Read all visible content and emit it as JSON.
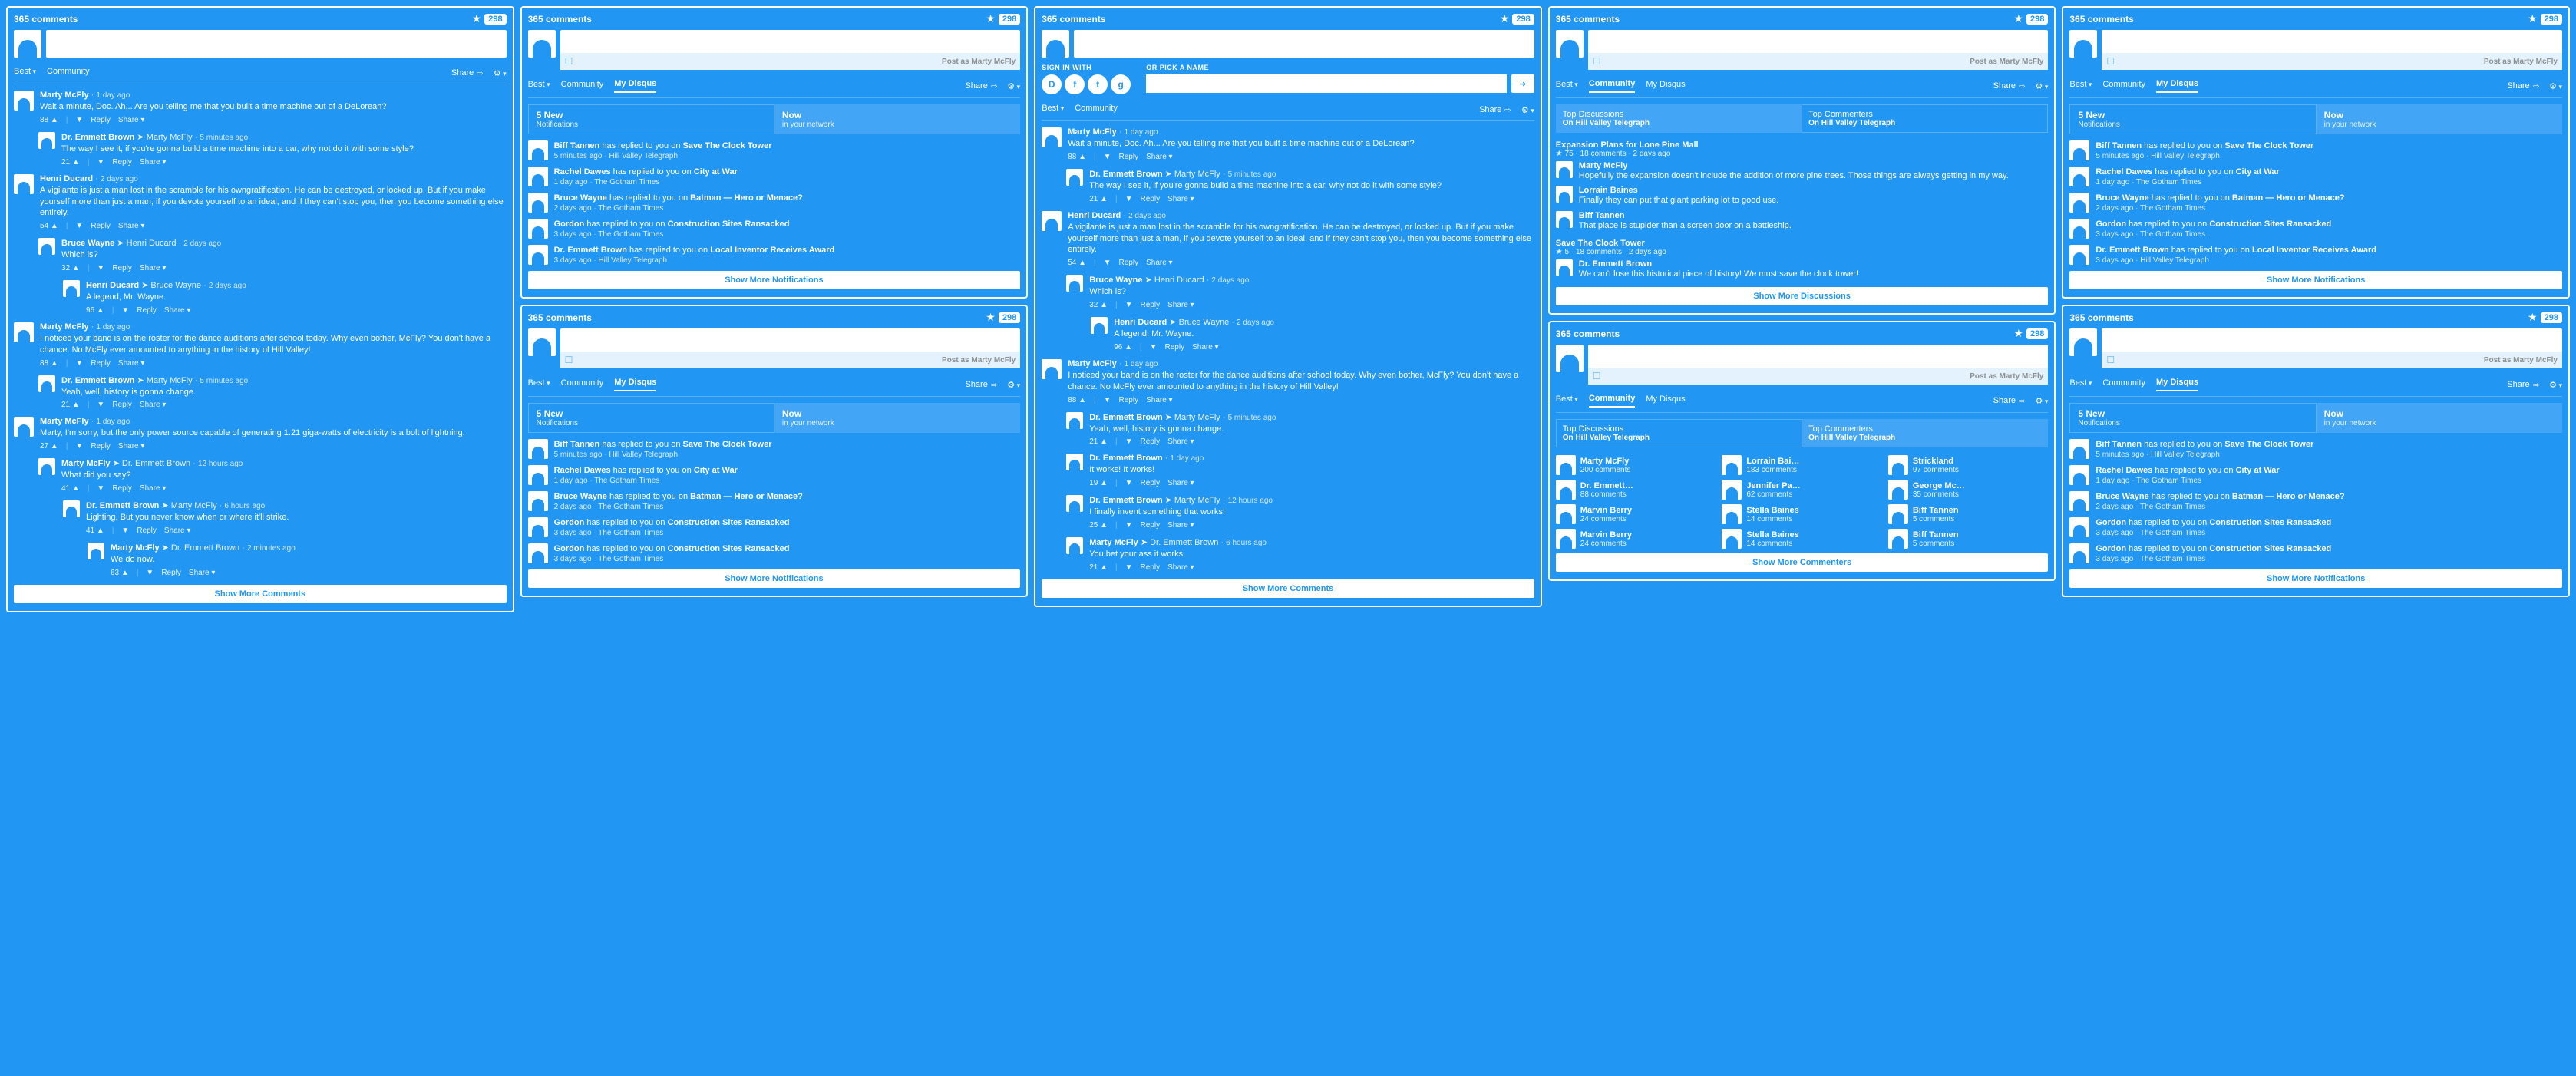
{
  "global": {
    "comments_title": "365 comments",
    "favorite_count": "298",
    "post_as": "Post as Marty McFly",
    "tabs": {
      "best": "Best",
      "community": "Community",
      "my_disqus": "My Disqus"
    },
    "toolbar": {
      "share": "Share",
      "settings": ""
    },
    "notif_tabs": {
      "count": "5 New",
      "count_sub": "Notifications",
      "now": "Now",
      "now_sub": "in your network"
    },
    "show_more_comments": "Show More Comments",
    "show_more_notifications": "Show More Notifications",
    "show_more_discussions": "Show More Discussions",
    "show_more_commenters": "Show More Commenters",
    "signin_with": "SIGN IN WITH",
    "pick_name": "OR PICK A NAME",
    "social": {
      "d": "D",
      "f": "f",
      "t": "t",
      "g": "g"
    }
  },
  "actions": {
    "reply": "Reply",
    "share": "Share",
    "up": "▲",
    "down": "▼",
    "sep": "|"
  },
  "community_tabs": {
    "top_disc": "Top Discussions",
    "top_disc_sub": "On Hill Valley Telegraph",
    "top_comm": "Top Commenters",
    "top_comm_sub": "On Hill Valley Telegraph"
  },
  "notifications": [
    {
      "who": "Biff Tannen",
      "action": "has replied to you on",
      "topic": "Save The Clock Tower",
      "time": "5 minutes ago",
      "source": "Hill Valley Telegraph"
    },
    {
      "who": "Rachel Dawes",
      "action": "has replied to you on",
      "topic": "City at War",
      "time": "1 day ago",
      "source": "The Gotham Times"
    },
    {
      "who": "Bruce Wayne",
      "action": "has replied to you on",
      "topic": "Batman — Hero or Menace?",
      "time": "2 days ago",
      "source": "The Gotham Times"
    },
    {
      "who": "Gordon",
      "action": "has replied to you on",
      "topic": "Construction Sites Ransacked",
      "time": "3 days ago",
      "source": "The Gotham Times"
    },
    {
      "who": "Dr. Emmett Brown",
      "action": "has replied to you on",
      "topic": "Local Inventor Receives Award",
      "time": "3 days ago",
      "source": "Hill Valley Telegraph"
    }
  ],
  "notifications_short": [
    {
      "who": "Biff Tannen",
      "action": "has replied to you on",
      "topic": "Save The Clock Tower",
      "time": "5 minutes ago",
      "source": "Hill Valley Telegraph"
    },
    {
      "who": "Rachel Dawes",
      "action": "has replied to you on",
      "topic": "City at War",
      "time": "1 day ago",
      "source": "The Gotham Times"
    },
    {
      "who": "Bruce Wayne",
      "action": "has replied to you on",
      "topic": "Batman — Hero or Menace?",
      "time": "2 days ago",
      "source": "The Gotham Times"
    },
    {
      "who": "Gordon",
      "action": "has replied to you on",
      "topic": "Construction Sites Ransacked",
      "time": "3 days ago",
      "source": "The Gotham Times"
    },
    {
      "who": "Gordon",
      "action": "has replied to you on",
      "topic": "Construction Sites Ransacked",
      "time": "3 days ago",
      "source": "The Gotham Times"
    }
  ],
  "discussions": [
    {
      "title": "Expansion Plans for Lone Pine Mall",
      "stars": "★ 75",
      "comments": "18 comments",
      "time": "2 days ago",
      "replies": [
        {
          "name": "Marty McFly",
          "text": "Hopefully the expansion doesn't include the addition of more pine trees. Those things are always getting in my way."
        },
        {
          "name": "Lorrain Baines",
          "text": "Finally they can put that giant parking lot to good use."
        },
        {
          "name": "Biff Tannen",
          "text": "That place is stupider than a screen door on a battleship."
        }
      ]
    },
    {
      "title": "Save The Clock Tower",
      "stars": "★ 5",
      "comments": "18 comments",
      "time": "2 days ago",
      "replies": [
        {
          "name": "Dr. Emmett Brown",
          "text": "We can't lose this historical piece of history! We must save the clock tower!"
        }
      ]
    }
  ],
  "commenters": [
    {
      "name": "Marty McFly",
      "count": "200 comments"
    },
    {
      "name": "Lorrain Baines",
      "count": "183 comments"
    },
    {
      "name": "Strickland",
      "count": "97 comments"
    },
    {
      "name": "Dr. Emmett Br...",
      "count": "88 comments"
    },
    {
      "name": "Jennifer Parker",
      "count": "62 comments"
    },
    {
      "name": "George McFly",
      "count": "35 comments"
    },
    {
      "name": "Marvin Berry",
      "count": "24 comments"
    },
    {
      "name": "Stella Baines",
      "count": "14 comments"
    },
    {
      "name": "Biff Tannen",
      "count": "5 comments"
    },
    {
      "name": "Marvin Berry",
      "count": "24 comments"
    },
    {
      "name": "Stella Baines",
      "count": "14 comments"
    },
    {
      "name": "Biff Tannen",
      "count": "5 comments"
    }
  ],
  "thread": [
    {
      "indent": 0,
      "name": "Marty McFly",
      "time": "1 day ago",
      "text": "Wait a minute, Doc. Ah... Are you telling me that you built a time machine out of a DeLorean?",
      "votes": "88"
    },
    {
      "indent": 1,
      "name": "Dr. Emmett Brown",
      "reply_to": "Marty McFly",
      "time": "5 minutes ago",
      "text": "The way I see it, if you're gonna build a time machine into a car, why not do it with some style?",
      "votes": "21"
    },
    {
      "indent": 0,
      "name": "Henri Ducard",
      "time": "2 days ago",
      "text": "A vigilante is just a man lost in the scramble for his owngratification. He can be destroyed, or locked up. But if you make yourself more than just a man, if you devote yourself to an ideal, and if they can't stop you, then you become something else entirely.",
      "votes": "54"
    },
    {
      "indent": 1,
      "name": "Bruce Wayne",
      "reply_to": "Henri Ducard",
      "time": "2 days ago",
      "text": "Which is?",
      "votes": "32"
    },
    {
      "indent": 2,
      "name": "Henri Ducard",
      "reply_to": "Bruce Wayne",
      "time": "2 days ago",
      "text": "A legend, Mr. Wayne.",
      "votes": "96"
    },
    {
      "indent": 0,
      "name": "Marty McFly",
      "time": "1 day ago",
      "text": "I noticed your band is on the roster for the dance auditions after school today. Why even bother, McFly? You don't have a chance. No McFly ever amounted to anything in the history of Hill Valley!",
      "votes": "88"
    },
    {
      "indent": 1,
      "name": "Dr. Emmett Brown",
      "reply_to": "Marty McFly",
      "time": "5 minutes ago",
      "text": "Yeah, well, history is gonna change.",
      "votes": "21"
    },
    {
      "indent": 0,
      "name": "Marty McFly",
      "time": "1 day ago",
      "text": "Marty, I'm sorry, but the only power source capable of generating 1.21 giga-watts of electricity is a bolt of lightning.",
      "votes": "27"
    },
    {
      "indent": 1,
      "name": "Marty McFly",
      "reply_to": "Dr. Emmett Brown",
      "time": "12 hours ago",
      "text": "What did you say?",
      "votes": "41"
    },
    {
      "indent": 2,
      "name": "Dr. Emmett Brown",
      "reply_to": "Marty McFly",
      "time": "6 hours ago",
      "text": "Lighting. But you never know when or where it'll strike.",
      "votes": "41"
    },
    {
      "indent": 3,
      "name": "Marty McFly",
      "reply_to": "Dr. Emmett Brown",
      "time": "2 minutes ago",
      "text": "We do now.",
      "votes": "63"
    }
  ],
  "thread2": [
    {
      "indent": 0,
      "name": "Marty McFly",
      "time": "1 day ago",
      "text": "Wait a minute, Doc. Ah... Are you telling me that you built a time machine out of a DeLorean?",
      "votes": "88"
    },
    {
      "indent": 1,
      "name": "Dr. Emmett Brown",
      "reply_to": "Marty McFly",
      "time": "5 minutes ago",
      "text": "The way I see it, if you're gonna build a time machine into a car, why not do it with some style?",
      "votes": "21"
    },
    {
      "indent": 0,
      "name": "Henri Ducard",
      "time": "2 days ago",
      "text": "A vigilante is just a man lost in the scramble for his owngratification. He can be destroyed, or locked up. But if you make yourself more than just a man, if you devote yourself to an ideal, and if they can't stop you, then you become something else entirely.",
      "votes": "54"
    },
    {
      "indent": 1,
      "name": "Bruce Wayne",
      "reply_to": "Henri Ducard",
      "time": "2 days ago",
      "text": "Which is?",
      "votes": "32"
    },
    {
      "indent": 2,
      "name": "Henri Ducard",
      "reply_to": "Bruce Wayne",
      "time": "2 days ago",
      "text": "A legend, Mr. Wayne.",
      "votes": "96"
    },
    {
      "indent": 0,
      "name": "Marty McFly",
      "time": "1 day ago",
      "text": "I noticed your band is on the roster for the dance auditions after school today. Why even bother, McFly? You don't have a chance. No McFly ever amounted to anything in the history of Hill Valley!",
      "votes": "88"
    },
    {
      "indent": 1,
      "name": "Dr. Emmett Brown",
      "reply_to": "Marty McFly",
      "time": "5 minutes ago",
      "text": "Yeah, well, history is gonna change.",
      "votes": "21"
    },
    {
      "indent": 1,
      "name": "Dr. Emmett Brown",
      "time": "1 day ago",
      "text": "It works! It works!",
      "votes": "19"
    },
    {
      "indent": 1,
      "name": "Dr. Emmett Brown",
      "reply_to": "Marty McFly",
      "time": "12 hours ago",
      "text": "I finally invent something that works!",
      "votes": "25"
    },
    {
      "indent": 1,
      "name": "Marty McFly",
      "reply_to": "Dr. Emmett Brown",
      "time": "6 hours ago",
      "text": "You bet your ass it works.",
      "votes": "21"
    }
  ]
}
